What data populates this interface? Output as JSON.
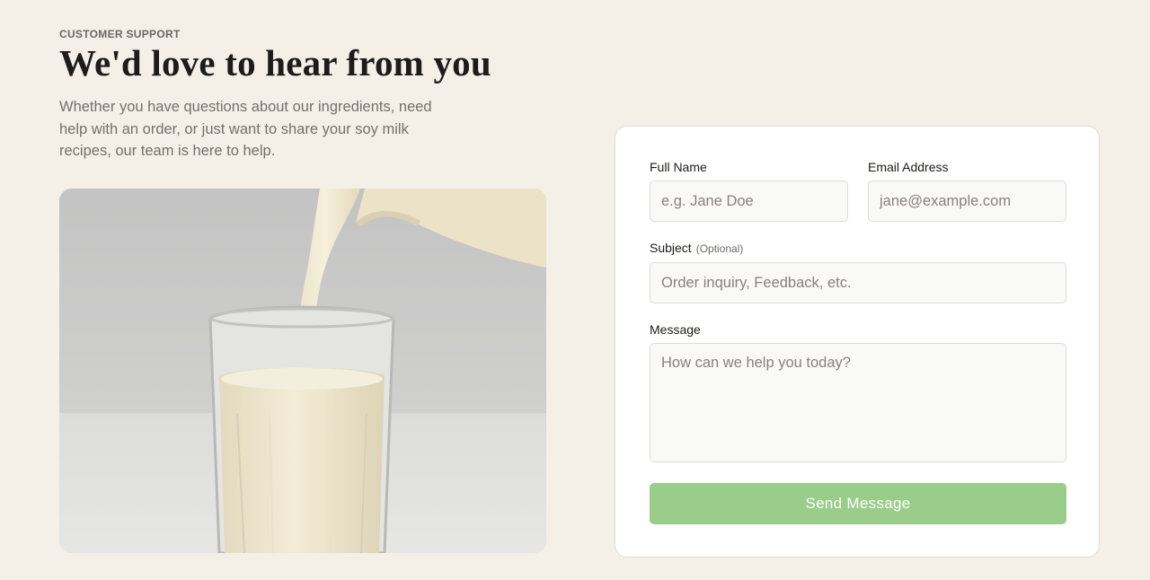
{
  "hero": {
    "eyebrow": "CUSTOMER SUPPORT",
    "title": "We'd love to hear from you",
    "intro": "Whether you have questions about our ingredients, need help with an order, or just want to share your soy milk recipes, our team is here to help."
  },
  "form": {
    "full_name": {
      "label": "Full Name",
      "placeholder": "e.g. Jane Doe",
      "value": ""
    },
    "email": {
      "label": "Email Address",
      "placeholder": "jane@example.com",
      "value": ""
    },
    "subject": {
      "label": "Subject",
      "optional": "(Optional)",
      "placeholder": "Order inquiry, Feedback, etc.",
      "value": ""
    },
    "message": {
      "label": "Message",
      "placeholder": "How can we help you today?",
      "value": ""
    },
    "submit_label": "Send Message"
  },
  "colors": {
    "page_background": "#f4f0e8",
    "card_background": "#ffffff",
    "submit_button": "#9acc8a",
    "heading_text": "#1d1c1a",
    "muted_text": "#75716a"
  }
}
